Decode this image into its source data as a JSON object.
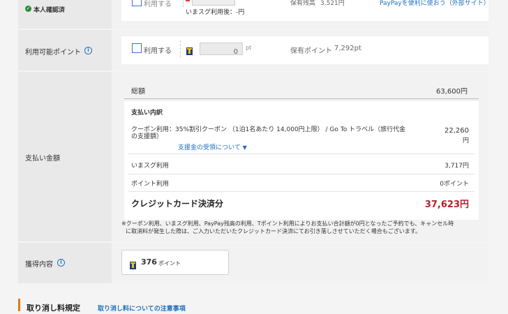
{
  "top_row": {
    "label": "本人確認済",
    "checkbox_label": "利用する",
    "after_use": "いまスグ利用後：-円",
    "balance_label": "保有残高",
    "balance_value": "3,521円",
    "paypay_link": "PayPayを便利に使おう（外部サイト）"
  },
  "points_row": {
    "label": "利用可能ポイント",
    "checkbox_label": "利用する",
    "input_value": "0",
    "unit": "pt",
    "held_label": "保有ポイント",
    "held_value": "7,292pt"
  },
  "payment_row": {
    "label": "支払い金額",
    "total_label": "総額",
    "total_value": "63,600円",
    "breakdown_title": "支払い内訳",
    "coupon_line1": "クーポン利用：35%割引クーポン （1泊1名あたり 14,000円上限） / Go To トラベル（旅行代金",
    "coupon_line2": "の支援額）",
    "coupon_value_1": "22,260",
    "coupon_value_2": "円",
    "subsidy_link": "支援金の受領について",
    "subsidy_arrow": "▼",
    "imasugu_label": "いまスグ利用",
    "imasugu_value": "3,717円",
    "point_label": "ポイント利用",
    "point_value": "0ポイント",
    "credit_label": "クレジットカード決済分",
    "credit_value": "37,623円",
    "note_line1": "※クーポン利用、いまスグ利用、PayPay残高の利用、Tポイント利用によりお支払い合計額が0円となったご予約でも、キャンセル時",
    "note_line2": "に取消料が発生した際は、ご入力いただいたクレジットカード決済にてお引き落しさせていただく場合もございます。"
  },
  "earn_row": {
    "label": "獲得内容",
    "points_number": "376",
    "points_unit": "ポイント"
  },
  "cancel_section": {
    "title": "取り消し料規定",
    "link": "取り消し料についての注意事項"
  },
  "colors": {
    "accent_link": "#1f6fbf",
    "price_red": "#b3202a",
    "section_bar": "#e07b00",
    "verified_green": "#2e8b3a"
  }
}
